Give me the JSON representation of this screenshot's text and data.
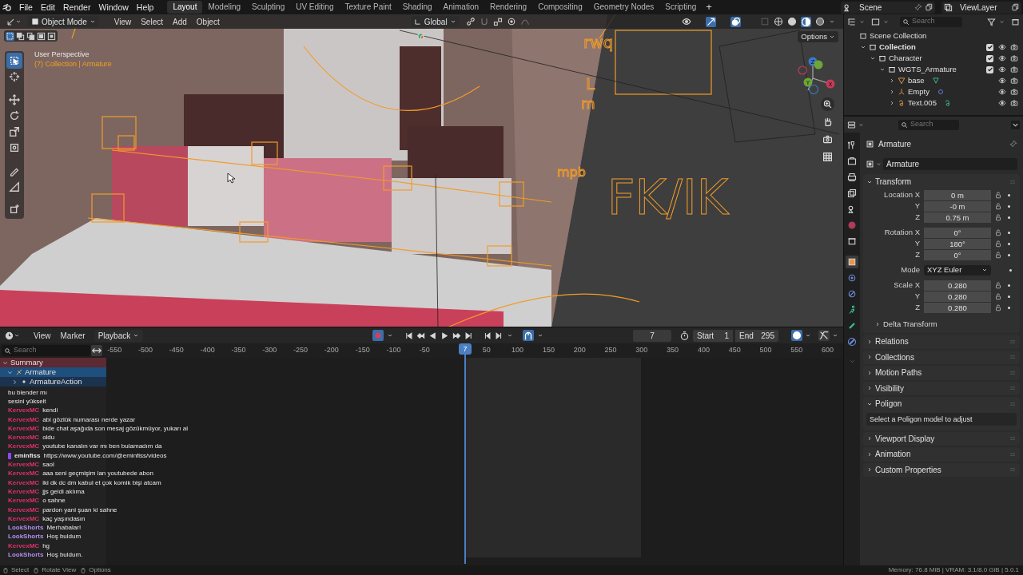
{
  "top_bar": {
    "menus": [
      "File",
      "Edit",
      "Render",
      "Window",
      "Help"
    ],
    "workspaces": [
      {
        "label": "Layout",
        "selected": true
      },
      {
        "label": "Modeling",
        "selected": false
      },
      {
        "label": "Sculpting",
        "selected": false
      },
      {
        "label": "UV Editing",
        "selected": false
      },
      {
        "label": "Texture Paint",
        "selected": false
      },
      {
        "label": "Shading",
        "selected": false
      },
      {
        "label": "Animation",
        "selected": false
      },
      {
        "label": "Rendering",
        "selected": false
      },
      {
        "label": "Compositing",
        "selected": false
      },
      {
        "label": "Geometry Nodes",
        "selected": false
      },
      {
        "label": "Scripting",
        "selected": false
      }
    ],
    "add_workspace": "+",
    "scene": "Scene",
    "view_layer": "ViewLayer"
  },
  "viewport": {
    "mode": "Object Mode",
    "menus": [
      "View",
      "Select",
      "Add",
      "Object"
    ],
    "orientation": "Global",
    "options": "Options",
    "perspective": "User Perspective",
    "context": "(7) Collection | Armature",
    "scene_text": [
      "rwq",
      "L",
      "m",
      "mpb",
      "FK/IK"
    ],
    "gizmo_labels": [
      "Z",
      "Y",
      "X"
    ]
  },
  "timeline": {
    "menus": [
      "View",
      "Marker"
    ],
    "playback": "Playback",
    "current_frame": "7",
    "start_label": "Start",
    "start": "1",
    "end_label": "End",
    "end": "295",
    "search_placeholder": "Search",
    "playhead": "7",
    "ruler_negative": [
      "-550",
      "-500",
      "-450",
      "-400",
      "-350",
      "-300",
      "-250",
      "-200",
      "-150",
      "-100",
      "-50"
    ],
    "ruler_positive": [
      "50",
      "100",
      "150",
      "200",
      "250",
      "300",
      "350",
      "400",
      "450",
      "500",
      "550",
      "600"
    ],
    "channels": [
      {
        "label": "Summary",
        "kind": "summary",
        "expanded": true,
        "children": [
          {
            "label": "Armature",
            "kind": "object",
            "expanded": true,
            "children": [
              {
                "label": "ArmatureAction",
                "kind": "action",
                "expanded": false
              }
            ]
          }
        ]
      }
    ]
  },
  "chat": [
    {
      "text": "bu blender mı",
      "badge": false
    },
    {
      "text": "sesini yükselt",
      "badge": false
    },
    {
      "user": "KervexMC",
      "color": "#e0306a",
      "text": "kendi",
      "badge": false
    },
    {
      "user": "KervexMC",
      "color": "#e0306a",
      "text": "abi gözlük numarası nerde yazar",
      "badge": false
    },
    {
      "user": "KervexMC",
      "color": "#e0306a",
      "text": "bide chat aşağıda son mesaj gözükmüyor, yukarı al",
      "badge": false
    },
    {
      "user": "KervexMC",
      "color": "#e0306a",
      "text": "oldu",
      "badge": false
    },
    {
      "user": "KervexMC",
      "color": "#e0306a",
      "text": "youtube kanalın var mı ben bulamadım da",
      "badge": false
    },
    {
      "user": "eminfiss",
      "color": "#e8e8e8",
      "text": "https://www.youtube.com/@eminfiss/videos",
      "badge": true
    },
    {
      "user": "KervexMC",
      "color": "#e0306a",
      "text": "saol",
      "badge": false
    },
    {
      "user": "KervexMC",
      "color": "#e0306a",
      "text": "aaa seni geçmişim lan youtubede abon",
      "badge": false
    },
    {
      "user": "KervexMC",
      "color": "#e0306a",
      "text": "iki dk dc dm kabul et çok komik bişi atcam",
      "badge": false
    },
    {
      "user": "KervexMC",
      "color": "#e0306a",
      "text": "jjs geldi aklıma",
      "badge": false
    },
    {
      "user": "KervexMC",
      "color": "#e0306a",
      "text": "o sahne",
      "badge": false
    },
    {
      "user": "KervexMC",
      "color": "#e0306a",
      "text": "pardon yani şuan ki sahne",
      "badge": false
    },
    {
      "user": "KervexMC",
      "color": "#e0306a",
      "text": "kaç yaşındasın",
      "badge": false
    },
    {
      "user": "LookShorts",
      "color": "#b48cf2",
      "text": "Merhabalar!",
      "badge": false
    },
    {
      "user": "LookShorts",
      "color": "#b48cf2",
      "text": "Hoş buldum",
      "badge": false
    },
    {
      "user": "KervexMC",
      "color": "#e0306a",
      "text": "hg",
      "badge": false
    },
    {
      "user": "LookShorts",
      "color": "#b48cf2",
      "text": "Hoş buldum.",
      "badge": false
    }
  ],
  "outliner": {
    "search_placeholder": "Search",
    "tree": [
      {
        "label": "Scene Collection",
        "kind": "scene",
        "children": [
          {
            "label": "Collection",
            "kind": "collection",
            "expanded": true,
            "checked": true,
            "children": [
              {
                "label": "Character",
                "kind": "collection",
                "expanded": true,
                "checked": true,
                "children": [
                  {
                    "label": "WGTS_Armature",
                    "kind": "collection",
                    "expanded": true,
                    "checked": true,
                    "children": [
                      {
                        "label": "base",
                        "kind": "mesh",
                        "expanded": false
                      },
                      {
                        "label": "Empty",
                        "kind": "empty",
                        "expanded": false
                      },
                      {
                        "label": "Text.005",
                        "kind": "text",
                        "expanded": false
                      }
                    ]
                  }
                ]
              }
            ]
          }
        ]
      }
    ]
  },
  "properties": {
    "search_placeholder": "Search",
    "object": "Armature",
    "datablock": "Armature",
    "transform_title": "Transform",
    "transform_expanded": true,
    "groups": [
      [
        {
          "label": "Location X",
          "value": "0 m",
          "kind": "number"
        },
        {
          "label": "Y",
          "value": "-0 m",
          "kind": "number"
        },
        {
          "label": "Z",
          "value": "0.75 m",
          "kind": "number"
        }
      ],
      [
        {
          "label": "Rotation X",
          "value": "0°",
          "kind": "number"
        },
        {
          "label": "Y",
          "value": "180°",
          "kind": "number"
        },
        {
          "label": "Z",
          "value": "0°",
          "kind": "number"
        }
      ],
      [
        {
          "label": "Mode",
          "value": "XYZ Euler",
          "kind": "dropdown"
        }
      ],
      [
        {
          "label": "Scale X",
          "value": "0.280",
          "kind": "number"
        },
        {
          "label": "Y",
          "value": "0.280",
          "kind": "number"
        },
        {
          "label": "Z",
          "value": "0.280",
          "kind": "number"
        }
      ]
    ],
    "delta": "Delta Transform",
    "panels": [
      {
        "title": "Relations",
        "expanded": false
      },
      {
        "title": "Collections",
        "expanded": false
      },
      {
        "title": "Motion Paths",
        "expanded": false
      },
      {
        "title": "Visibility",
        "expanded": false
      },
      {
        "title": "Poligon",
        "expanded": true,
        "message": "Select a Poligon model to adjust"
      },
      {
        "title": "Viewport Display",
        "expanded": false
      },
      {
        "title": "Animation",
        "expanded": false
      },
      {
        "title": "Custom Properties",
        "expanded": false
      }
    ]
  },
  "status_bar": {
    "hints": [
      "Select",
      "Rotate View",
      "Options"
    ],
    "stats": "Memory: 76.8 MiB | VRAM: 3.1/8.0 GiB | 5.0.1"
  }
}
